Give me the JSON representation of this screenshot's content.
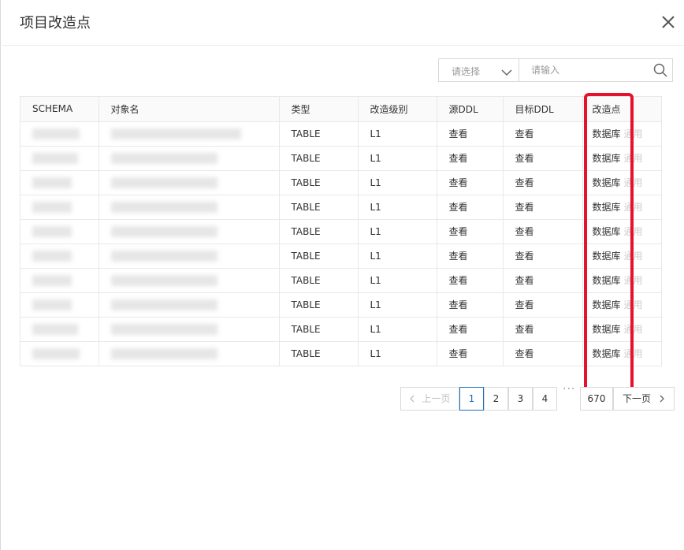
{
  "dialog": {
    "title": "项目改造点"
  },
  "filter": {
    "select_placeholder": "请选择",
    "search_placeholder": "请输入"
  },
  "table": {
    "columns": [
      "SCHEMA",
      "对象名",
      "类型",
      "改造级别",
      "源DDL",
      "目标DDL",
      "改造点"
    ],
    "rows": [
      {
        "type": "TABLE",
        "level": "L1",
        "src": "查看",
        "dst": "查看",
        "op": "数据库",
        "op2": "通用"
      },
      {
        "type": "TABLE",
        "level": "L1",
        "src": "查看",
        "dst": "查看",
        "op": "数据库",
        "op2": "通用"
      },
      {
        "type": "TABLE",
        "level": "L1",
        "src": "查看",
        "dst": "查看",
        "op": "数据库",
        "op2": "通用"
      },
      {
        "type": "TABLE",
        "level": "L1",
        "src": "查看",
        "dst": "查看",
        "op": "数据库",
        "op2": "通用"
      },
      {
        "type": "TABLE",
        "level": "L1",
        "src": "查看",
        "dst": "查看",
        "op": "数据库",
        "op2": "通用"
      },
      {
        "type": "TABLE",
        "level": "L1",
        "src": "查看",
        "dst": "查看",
        "op": "数据库",
        "op2": "通用"
      },
      {
        "type": "TABLE",
        "level": "L1",
        "src": "查看",
        "dst": "查看",
        "op": "数据库",
        "op2": "通用"
      },
      {
        "type": "TABLE",
        "level": "L1",
        "src": "查看",
        "dst": "查看",
        "op": "数据库",
        "op2": "通用"
      },
      {
        "type": "TABLE",
        "level": "L1",
        "src": "查看",
        "dst": "查看",
        "op": "数据库",
        "op2": "通用"
      },
      {
        "type": "TABLE",
        "level": "L1",
        "src": "查看",
        "dst": "查看",
        "op": "数据库",
        "op2": "通用"
      }
    ]
  },
  "pagination": {
    "prev_label": "上一页",
    "pages": [
      "1",
      "2",
      "3",
      "4"
    ],
    "active_page": "1",
    "ellipsis": "···",
    "last_page": "670",
    "next_label": "下一页"
  },
  "colors": {
    "highlight": "#e8112d",
    "accent": "#1e6fbd"
  }
}
